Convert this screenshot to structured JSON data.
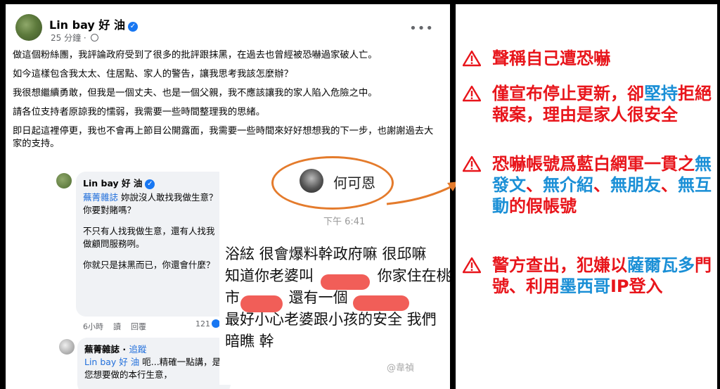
{
  "post": {
    "author": "Lin bay 好 油",
    "time": "25 分鐘",
    "more": "•••",
    "paragraphs": [
      "做這個粉絲團，我評論政府受到了很多的批評跟抹黑，在過去也曾經被恐嚇過家破人亡。",
      "如今這樣包含我太太、住居點、家人的警告，讓我思考我該怎麼辦？",
      "我很想繼續勇敢，但我是一個丈夫、也是一個父親，我不應該讓我的家人陷入危險之中。",
      "請各位支持者原諒我的懦弱，我需要一些時間整理我的思緒。",
      "即日起這裡停更，我也不會再上節目公開露面，我需要一些時間來好好想想我的下一步，也謝謝過去大家的支持。"
    ]
  },
  "comments": {
    "reply1": {
      "author": "Lin bay 好 油",
      "mention": "蕪菁雜誌",
      "text1": "妳說沒人敢找我做生意？你要對賭嗎？",
      "text2": "不只有人找我做生意，還有人找我做顧問服務咧。",
      "text3": "你就只是抹黑而已，你還會什麼？",
      "time": "6小時",
      "action_read": "讀",
      "action_reply": "回覆",
      "likes": "121"
    },
    "reply2": {
      "author": "蕪菁雜誌",
      "follow": "追蹤",
      "mention": "Lin bay 好 油",
      "text": "呃...精確一點講，是您想要做的本行生意，"
    }
  },
  "chat": {
    "name": "何可恩",
    "time": "下午 6:41",
    "lines": [
      "浴絃 很會爆料幹政府嘛 很邱嘛",
      "知道你老婆叫　　　　 你家住在桃",
      "市　　　 還有一個",
      "最好小心老婆跟小孩的安全 我們",
      "暗瞧 幹"
    ],
    "watermark": "@韋禎"
  },
  "annotations": {
    "items": [
      {
        "parts": [
          {
            "t": "聲稱自己遭恐嚇",
            "hl": false
          }
        ]
      },
      {
        "parts": [
          {
            "t": "僅宣布停止更新，卻",
            "hl": false
          },
          {
            "t": "堅持",
            "hl": true
          },
          {
            "t": "拒絕報案，理由是家人很安全",
            "hl": false
          }
        ]
      },
      {
        "parts": [
          {
            "t": "恐嚇帳號爲藍白網軍一貫之",
            "hl": false
          },
          {
            "t": "無發文",
            "hl": true
          },
          {
            "t": "、",
            "hl": false
          },
          {
            "t": "無介紹",
            "hl": true
          },
          {
            "t": "、",
            "hl": false
          },
          {
            "t": "無朋友",
            "hl": true
          },
          {
            "t": "、",
            "hl": false
          },
          {
            "t": "無互動",
            "hl": true
          },
          {
            "t": "的假帳號",
            "hl": false
          }
        ]
      },
      {
        "parts": [
          {
            "t": "警方查出，犯嫌以",
            "hl": false
          },
          {
            "t": "薩爾瓦多",
            "hl": true
          },
          {
            "t": "門號、利用",
            "hl": false
          },
          {
            "t": "墨西哥",
            "hl": true
          },
          {
            "t": "IP登入",
            "hl": false
          }
        ]
      }
    ],
    "colors": {
      "red": "#e8151b",
      "blue": "#1a8fd6",
      "orange": "#e47b2c"
    }
  }
}
